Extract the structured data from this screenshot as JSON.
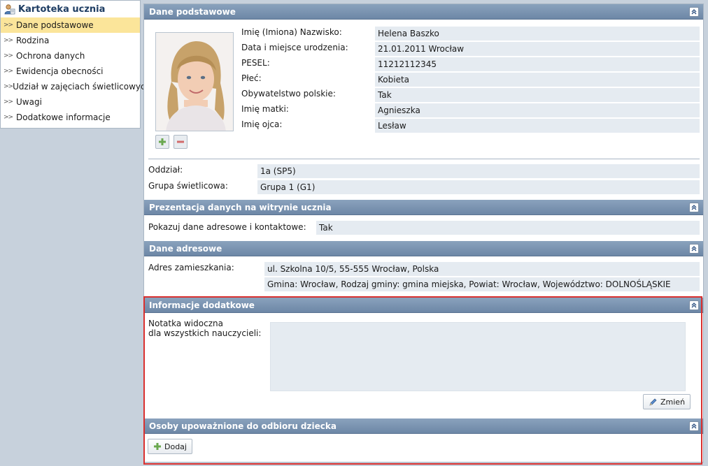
{
  "sidebar": {
    "title": "Kartoteka ucznia",
    "items": [
      {
        "label": "Dane podstawowe"
      },
      {
        "label": "Rodzina"
      },
      {
        "label": "Ochrona danych"
      },
      {
        "label": "Ewidencja obecności"
      },
      {
        "label": "Udział w zajęciach świetlicowych"
      },
      {
        "label": "Uwagi"
      },
      {
        "label": "Dodatkowe informacje"
      }
    ],
    "active_index": 0
  },
  "basic": {
    "header": "Dane podstawowe",
    "fields": [
      {
        "label": "Imię (Imiona) Nazwisko:",
        "value": "Helena Baszko"
      },
      {
        "label": "Data i miejsce urodzenia:",
        "value": "21.01.2011 Wrocław"
      },
      {
        "label": "PESEL:",
        "value": "11212112345"
      },
      {
        "label": "Płeć:",
        "value": "Kobieta"
      },
      {
        "label": "Obywatelstwo polskie:",
        "value": "Tak"
      },
      {
        "label": "Imię matki:",
        "value": "Agnieszka"
      },
      {
        "label": "Imię ojca:",
        "value": "Lesław"
      }
    ],
    "class_fields": [
      {
        "label": "Oddział:",
        "value": "1a (SP5)"
      },
      {
        "label": "Grupa świetlicowa:",
        "value": "Grupa 1 (G1)"
      }
    ]
  },
  "presentation": {
    "header": "Prezentacja danych na witrynie ucznia",
    "label": "Pokazuj dane adresowe i kontaktowe:",
    "value": "Tak"
  },
  "address": {
    "header": "Dane adresowe",
    "label": "Adres zamieszkania:",
    "line1": "ul. Szkolna 10/5, 55-555 Wrocław, Polska",
    "line2": "Gmina: Wrocław, Rodzaj gminy: gmina miejska, Powiat: Wrocław, Województwo: DOLNOŚLĄSKIE"
  },
  "additional": {
    "header": "Informacje dodatkowe",
    "note_label_1": "Notatka widoczna",
    "note_label_2": "dla wszystkich nauczycieli:",
    "note_value": "",
    "change_button": "Zmień"
  },
  "pickup": {
    "header": "Osoby upoważnione do odbioru dziecka",
    "add_button": "Dodaj"
  },
  "icons": {
    "user": "user-card-icon",
    "collapse": "collapse-up-icon",
    "add_photo": "plus-icon",
    "remove_photo": "minus-icon",
    "edit": "pencil-icon"
  },
  "colors": {
    "header_bg": "#7d96b4",
    "active_nav": "#fbe59a",
    "value_bg": "#e5ebf1",
    "highlight_frame": "#d9302f"
  }
}
